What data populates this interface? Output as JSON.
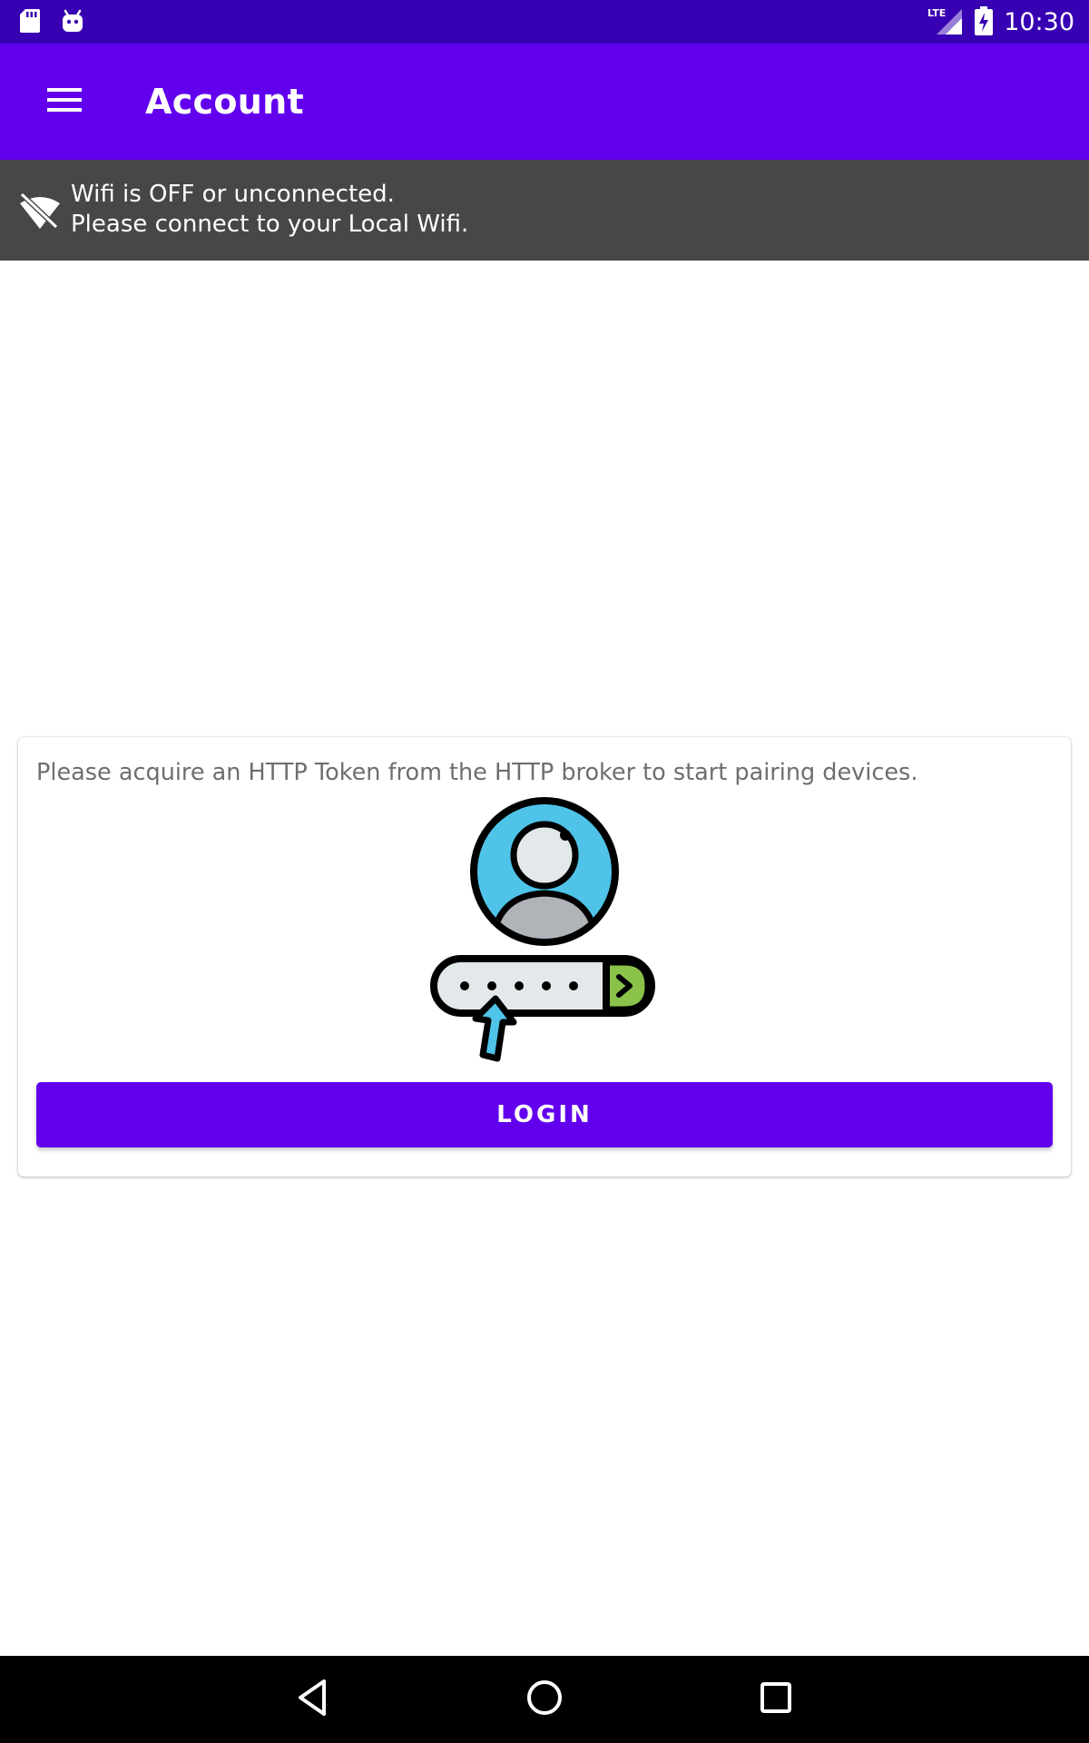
{
  "status_bar": {
    "time": "10:30",
    "network_label": "LTE",
    "icons": [
      "sd-card-icon",
      "android-icon",
      "lte-signal-icon",
      "battery-charging-icon"
    ]
  },
  "app_bar": {
    "title": "Account",
    "menu_icon": "hamburger-menu-icon"
  },
  "wifi_banner": {
    "icon": "wifi-off-icon",
    "line1": "Wifi is OFF or unconnected.",
    "line2": "Please connect to your Local Wifi."
  },
  "card": {
    "message": "Please acquire an HTTP Token from the HTTP broker to start pairing devices.",
    "illustration": "user-login-password-icon",
    "login_label": "LOGIN"
  },
  "nav_bar": {
    "icons": [
      "back-icon",
      "home-icon",
      "recents-icon"
    ]
  },
  "colors": {
    "status_bar": "#3700b3",
    "primary": "#6200ee",
    "banner": "#474747",
    "illustration_blue": "#4fc3e8",
    "illustration_green": "#8bc34a"
  }
}
